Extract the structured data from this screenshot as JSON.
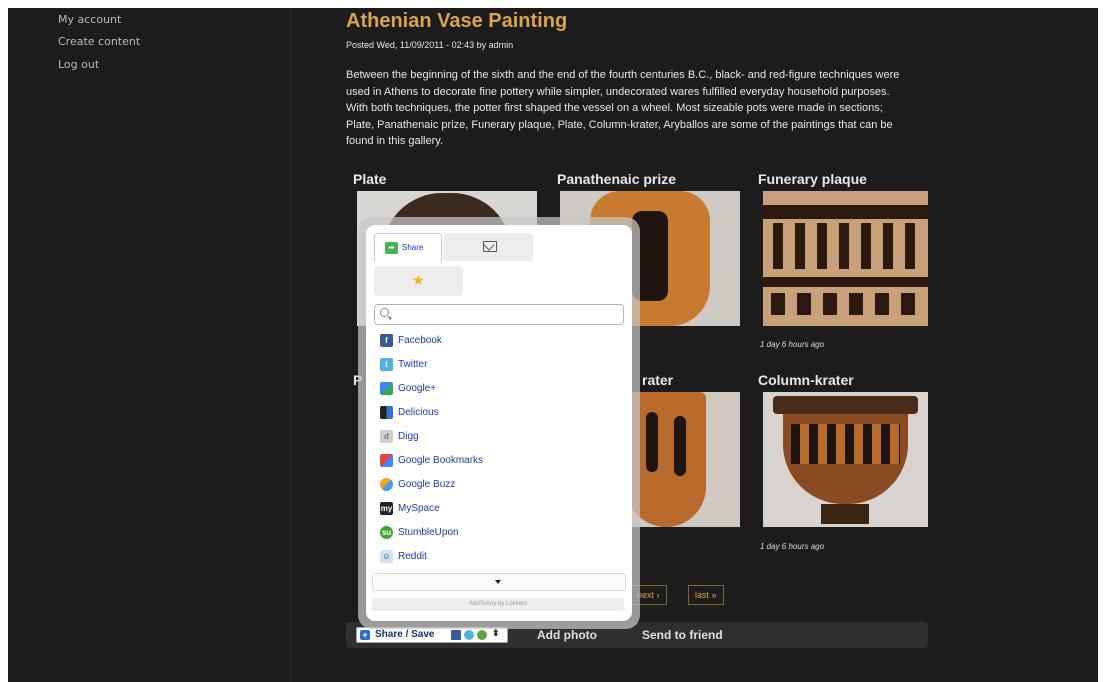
{
  "sidebar": {
    "links": [
      "My account",
      "Create content",
      "Log out"
    ]
  },
  "article": {
    "title": "Athenian Vase Painting",
    "meta": "Posted Wed, 11/09/2011 - 02:43 by admin",
    "body": "Between the beginning of the sixth and the end of the fourth centuries B.C., black- and red-figure techniques were used in Athens to decorate fine pottery while simpler, undecorated wares fulfilled everyday household purposes. With both techniques, the potter first shaped the vessel on a wheel. Most sizeable pots were made in sections; Plate, Panathenaic prize, Funerary plaque, Plate, Column-krater, Aryballos are some of the paintings that can be found in this gallery."
  },
  "gallery": [
    {
      "title": "Plate",
      "time": ""
    },
    {
      "title": "Panathenaic prize",
      "time": ""
    },
    {
      "title": "Funerary plaque",
      "time": "1 day 6 hours ago"
    },
    {
      "title": "P",
      "time": ""
    },
    {
      "title": "rater",
      "time": ""
    },
    {
      "title": "Column-krater",
      "time": "1 day 6 hours ago"
    }
  ],
  "pager": {
    "next": "next ›",
    "last": "last »"
  },
  "links_bar": {
    "share_label": "Share / Save",
    "add_photo": "Add photo",
    "send_to_friend": "Send to friend"
  },
  "share_popup": {
    "tabs": [
      {
        "label": "Share",
        "icon": "share-icon"
      },
      {
        "label": "",
        "icon": "email-icon"
      },
      {
        "label": "",
        "icon": "star-icon"
      }
    ],
    "search_placeholder": "",
    "services": [
      {
        "name": "Facebook",
        "color": "#3b5998"
      },
      {
        "name": "Twitter",
        "color": "#4fb3e8"
      },
      {
        "name": "Google+",
        "color": "#dd4b39"
      },
      {
        "name": "Delicious",
        "color": "#3274d1"
      },
      {
        "name": "Digg",
        "color": "#bbbbbb"
      },
      {
        "name": "Google Bookmarks",
        "color": "#4285f4"
      },
      {
        "name": "Google Buzz",
        "color": "#f4a41f"
      },
      {
        "name": "MySpace",
        "color": "#222222"
      },
      {
        "name": "StumbleUpon",
        "color": "#3fa535"
      },
      {
        "name": "Reddit",
        "color": "#5f99cf"
      }
    ],
    "credit": "AddToAny by Lockerz"
  },
  "colors": {
    "background": "#1c1c1c",
    "accent": "#d9a44a",
    "text": "#e8e8e8"
  }
}
